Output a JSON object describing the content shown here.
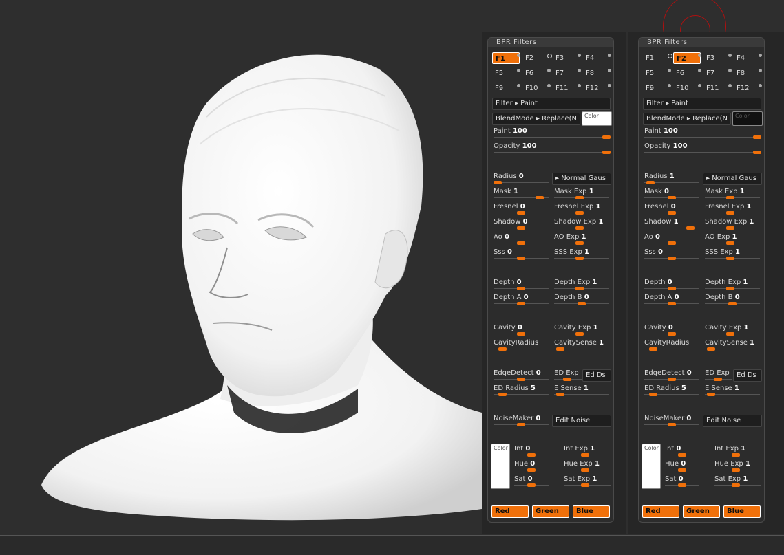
{
  "panels": [
    {
      "title": "BPR  Filters",
      "slots": [
        {
          "label": "F1",
          "active": true
        },
        {
          "label": "F2",
          "active": false
        },
        {
          "label": "F3",
          "active": false
        },
        {
          "label": "F4",
          "active": false
        },
        {
          "label": "F5",
          "active": false
        },
        {
          "label": "F6",
          "active": false
        },
        {
          "label": "F7",
          "active": false
        },
        {
          "label": "F8",
          "active": false
        },
        {
          "label": "F9",
          "active": false
        },
        {
          "label": "F10",
          "active": false
        },
        {
          "label": "F11",
          "active": false
        },
        {
          "label": "F12",
          "active": false
        }
      ],
      "filter": "Filter ▸ Paint",
      "blendmode": "BlendMode ▸ Replace(N",
      "blend_color_label": "Color",
      "blend_color": "#ffffff",
      "paint": {
        "label": "Paint",
        "value": "100",
        "level": 1.0
      },
      "opacity": {
        "label": "Opacity",
        "value": "100",
        "level": 1.0
      },
      "radius": {
        "label": "Radius",
        "value": "0",
        "level": 0.0
      },
      "normal_gauss": "▸ Normal  Gaus",
      "rows_left": [
        {
          "label": "Mask",
          "value": "1",
          "level": 0.9
        },
        {
          "label": "Fresnel",
          "value": "0",
          "level": 0.5
        },
        {
          "label": "Shadow",
          "value": "0",
          "level": 0.5
        },
        {
          "label": "Ao",
          "value": "0",
          "level": 0.5
        },
        {
          "label": "Sss",
          "value": "0",
          "level": 0.5
        },
        {
          "label": "Depth",
          "value": "0",
          "level": 0.5
        },
        {
          "label": "Depth  A",
          "value": "0",
          "level": 0.5
        },
        {
          "label": "Cavity",
          "value": "0",
          "level": 0.5
        },
        {
          "label": "CavityRadius",
          "value": "",
          "level": 0.1
        },
        {
          "label": "EdgeDetect",
          "value": "0",
          "level": 0.5
        },
        {
          "label": "ED  Radius",
          "value": "5",
          "level": 0.1
        },
        {
          "label": "NoiseMaker",
          "value": "0",
          "level": 0.5
        }
      ],
      "rows_right": [
        {
          "label": "Mask  Exp",
          "value": "1",
          "level": 0.45
        },
        {
          "label": "Fresnel  Exp",
          "value": "1",
          "level": 0.45
        },
        {
          "label": "Shadow  Exp",
          "value": "1",
          "level": 0.45
        },
        {
          "label": "AO  Exp",
          "value": "1",
          "level": 0.45
        },
        {
          "label": "SSS  Exp",
          "value": "1",
          "level": 0.45
        },
        {
          "label": "Depth  Exp",
          "value": "1",
          "level": 0.45
        },
        {
          "label": "Depth  B",
          "value": "0",
          "level": 0.5
        },
        {
          "label": "Cavity  Exp",
          "value": "1",
          "level": 0.45
        },
        {
          "label": "CavitySense",
          "value": "1",
          "level": 0.05
        },
        {
          "label": "ED  Exp",
          "value": "",
          "level": 0.45
        },
        {
          "label": "E  Sense",
          "value": "1",
          "level": 0.05
        }
      ],
      "ed_ds": "Ed  Ds",
      "edit_noise": "Edit  Noise",
      "noise_color_label": "Color",
      "hsi_left": [
        {
          "label": "Int",
          "value": "0",
          "level": 0.5
        },
        {
          "label": "Hue",
          "value": "0",
          "level": 0.5
        },
        {
          "label": "Sat",
          "value": "0",
          "level": 0.5
        }
      ],
      "hsi_right": [
        {
          "label": "Int  Exp",
          "value": "1",
          "level": 0.45
        },
        {
          "label": "Hue  Exp",
          "value": "1",
          "level": 0.45
        },
        {
          "label": "Sat  Exp",
          "value": "1",
          "level": 0.45
        }
      ],
      "channels": [
        "Red",
        "Green",
        "Blue"
      ]
    },
    {
      "title": "BPR  Filters",
      "slots": [
        {
          "label": "F1",
          "active": false
        },
        {
          "label": "F2",
          "active": true
        },
        {
          "label": "F3",
          "active": false
        },
        {
          "label": "F4",
          "active": false
        },
        {
          "label": "F5",
          "active": false
        },
        {
          "label": "F6",
          "active": false
        },
        {
          "label": "F7",
          "active": false
        },
        {
          "label": "F8",
          "active": false
        },
        {
          "label": "F9",
          "active": false
        },
        {
          "label": "F10",
          "active": false
        },
        {
          "label": "F11",
          "active": false
        },
        {
          "label": "F12",
          "active": false
        }
      ],
      "filter": "Filter ▸ Paint",
      "blendmode": "BlendMode ▸ Replace(N",
      "blend_color_label": "Color",
      "blend_color": "#111111",
      "paint": {
        "label": "Paint",
        "value": "100",
        "level": 1.0
      },
      "opacity": {
        "label": "Opacity",
        "value": "100",
        "level": 1.0
      },
      "radius": {
        "label": "Radius",
        "value": "1",
        "level": 0.05
      },
      "normal_gauss": "▸ Normal  Gaus",
      "rows_left": [
        {
          "label": "Mask",
          "value": "0",
          "level": 0.5
        },
        {
          "label": "Fresnel",
          "value": "0",
          "level": 0.5
        },
        {
          "label": "Shadow",
          "value": "1",
          "level": 0.9
        },
        {
          "label": "Ao",
          "value": "0",
          "level": 0.5
        },
        {
          "label": "Sss",
          "value": "0",
          "level": 0.5
        },
        {
          "label": "Depth",
          "value": "0",
          "level": 0.5
        },
        {
          "label": "Depth  A",
          "value": "0",
          "level": 0.5
        },
        {
          "label": "Cavity",
          "value": "0",
          "level": 0.5
        },
        {
          "label": "CavityRadius",
          "value": "",
          "level": 0.1
        },
        {
          "label": "EdgeDetect",
          "value": "0",
          "level": 0.5
        },
        {
          "label": "ED  Radius",
          "value": "5",
          "level": 0.1
        },
        {
          "label": "NoiseMaker",
          "value": "0",
          "level": 0.5
        }
      ],
      "rows_right": [
        {
          "label": "Mask  Exp",
          "value": "1",
          "level": 0.45
        },
        {
          "label": "Fresnel  Exp",
          "value": "1",
          "level": 0.45
        },
        {
          "label": "Shadow  Exp",
          "value": "1",
          "level": 0.45
        },
        {
          "label": "AO  Exp",
          "value": "1",
          "level": 0.45
        },
        {
          "label": "SSS  Exp",
          "value": "1",
          "level": 0.45
        },
        {
          "label": "Depth  Exp",
          "value": "1",
          "level": 0.45
        },
        {
          "label": "Depth  B",
          "value": "0",
          "level": 0.5
        },
        {
          "label": "Cavity  Exp",
          "value": "1",
          "level": 0.45
        },
        {
          "label": "CavitySense",
          "value": "1",
          "level": 0.05
        },
        {
          "label": "ED  Exp",
          "value": "",
          "level": 0.45
        },
        {
          "label": "E  Sense",
          "value": "1",
          "level": 0.05
        }
      ],
      "ed_ds": "Ed  Ds",
      "edit_noise": "Edit  Noise",
      "noise_color_label": "Color",
      "hsi_left": [
        {
          "label": "Int",
          "value": "0",
          "level": 0.5
        },
        {
          "label": "Hue",
          "value": "0",
          "level": 0.5
        },
        {
          "label": "Sat",
          "value": "0",
          "level": 0.5
        }
      ],
      "hsi_right": [
        {
          "label": "Int  Exp",
          "value": "1",
          "level": 0.45
        },
        {
          "label": "Hue  Exp",
          "value": "1",
          "level": 0.45
        },
        {
          "label": "Sat  Exp",
          "value": "1",
          "level": 0.45
        }
      ],
      "channels": [
        "Red",
        "Green",
        "Blue"
      ]
    }
  ],
  "colors": {
    "accent": "#f0700a",
    "background": "#2e2e2e"
  }
}
